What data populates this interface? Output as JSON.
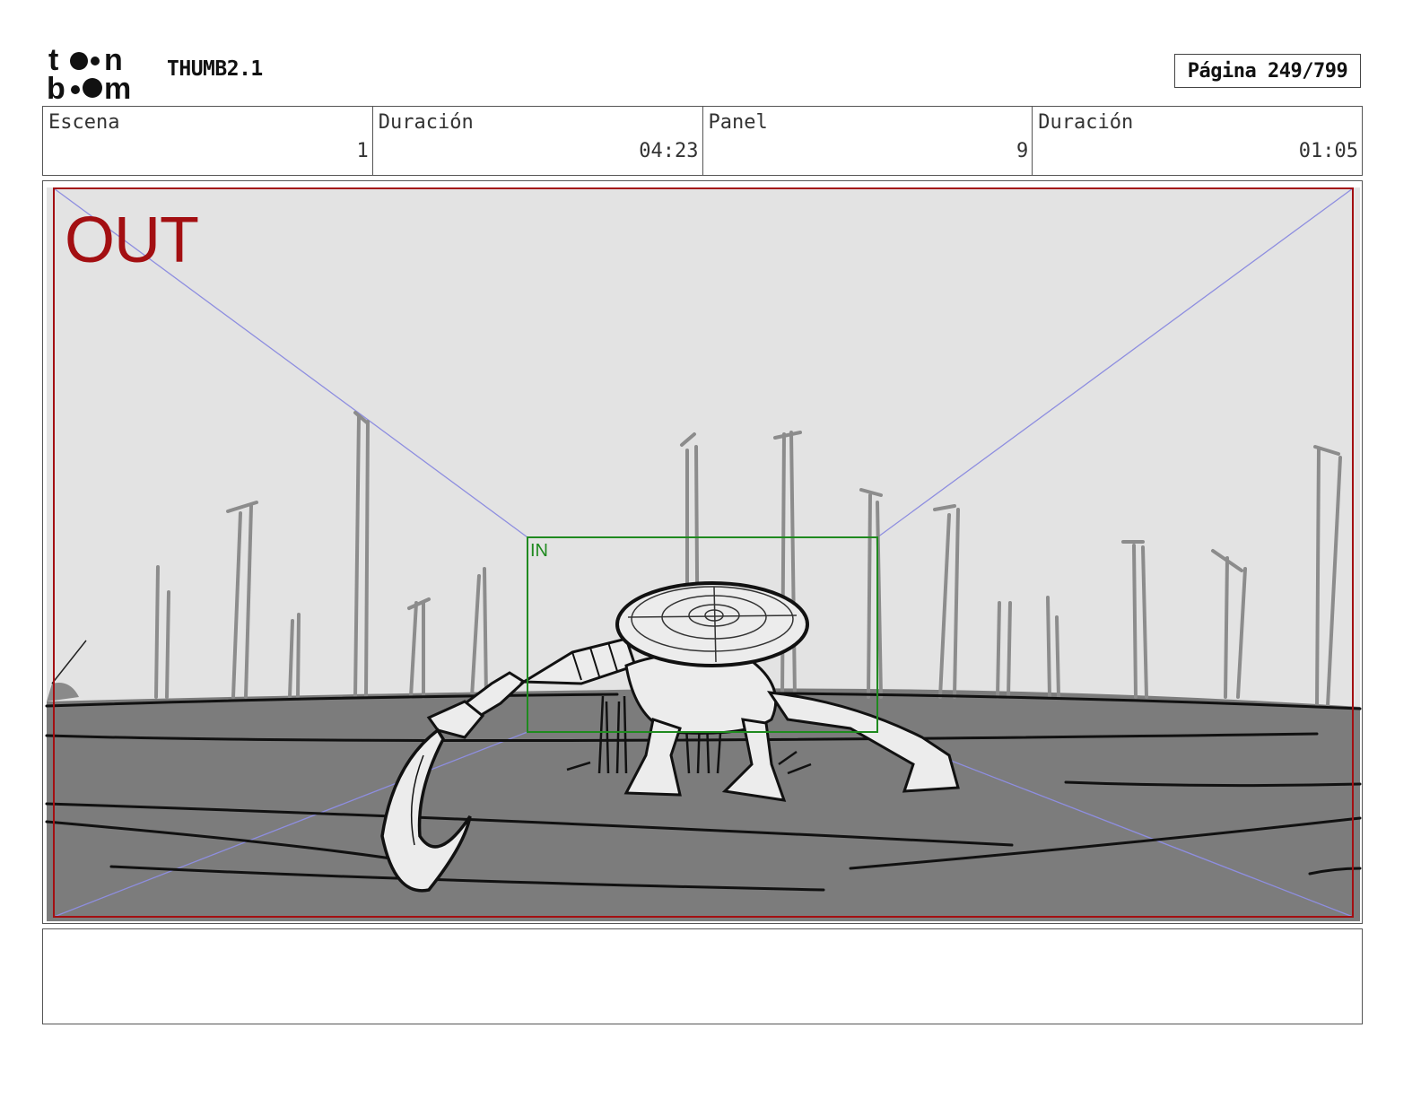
{
  "header": {
    "logo_text": "toon boom",
    "project_title": "THUMB2.1",
    "page_label": "Página 249/799"
  },
  "info": {
    "scene_label": "Escena",
    "scene_value": "1",
    "scene_duration_label": "Duración",
    "scene_duration_value": "04:23",
    "panel_label": "Panel",
    "panel_value": "9",
    "panel_duration_label": "Duración",
    "panel_duration_value": "01:05"
  },
  "panel": {
    "out_label": "OUT",
    "in_label": "IN",
    "colors": {
      "out_frame": "#a30f12",
      "in_frame": "#1f8a1f",
      "guides": "#8e8ee0",
      "sky": "#e3e3e3",
      "ground": "#7c7c7c"
    }
  },
  "notes": {
    "text": ""
  }
}
